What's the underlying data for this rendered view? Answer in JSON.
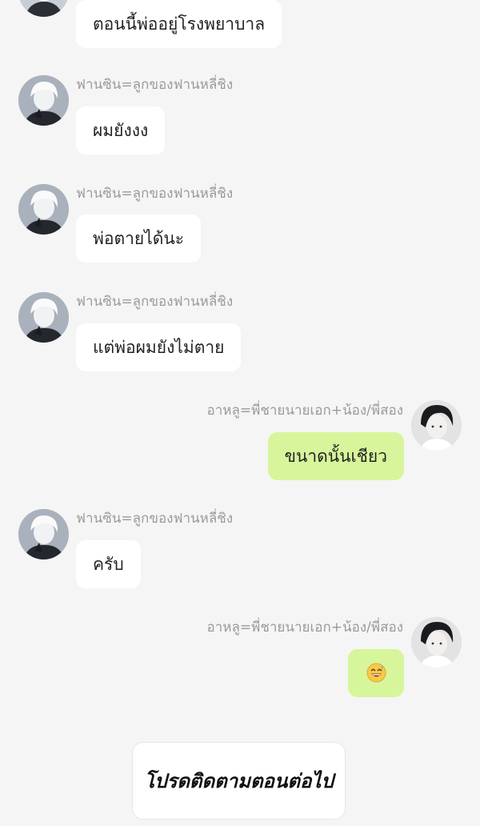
{
  "messages": [
    {
      "side": "left",
      "name": "",
      "text": "ตอนนี้พ่ออยู่โรงพยาบาล"
    },
    {
      "side": "left",
      "name": "ฟานซิน=ลูกของฟานหลี่ชิง",
      "text": "ผมยังงง"
    },
    {
      "side": "left",
      "name": "ฟานซิน=ลูกของฟานหลี่ชิง",
      "text": "พ่อตายได้นะ"
    },
    {
      "side": "left",
      "name": "ฟานซิน=ลูกของฟานหลี่ชิง",
      "text": "แต่พ่อผมยังไม่ตาย"
    },
    {
      "side": "right",
      "name": "อาหลู=พี่ชายนายเอก+น้อง/พี่สอง",
      "text": "ขนาดนั้นเชียว"
    },
    {
      "side": "left",
      "name": "ฟานซิน=ลูกของฟานหลี่ชิง",
      "text": "ครับ"
    },
    {
      "side": "right",
      "name": "อาหลู=พี่ชายนายเอก+น้อง/พี่สอง",
      "text": "",
      "emoji": "grinning-sweat-emoji"
    }
  ],
  "footer": {
    "text": "โปรดติดตามตอนต่อไป"
  },
  "colors": {
    "background": "#f5f5f5",
    "left_bubble": "#ffffff",
    "right_bubble": "#d7f59a",
    "name_text": "#9a9a9a"
  }
}
